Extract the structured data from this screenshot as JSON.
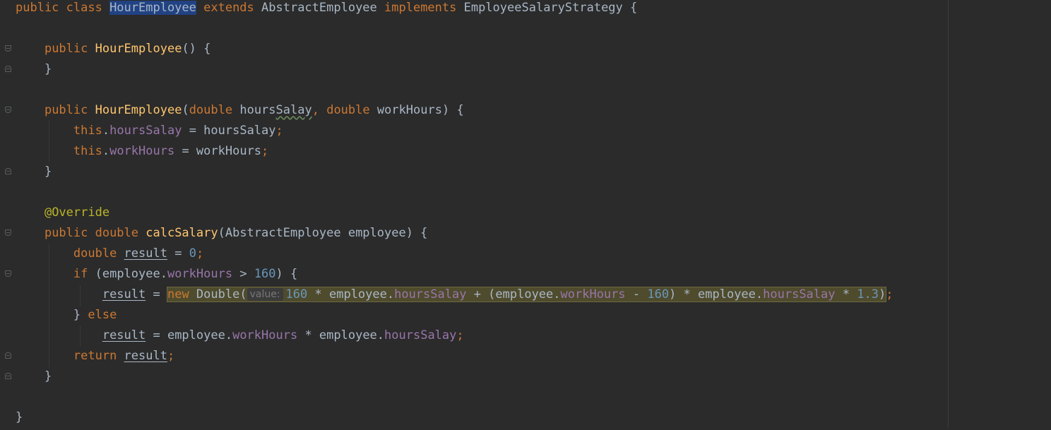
{
  "editor": {
    "lines": {
      "l1": {
        "kw1": "public class ",
        "name": "HourEmployee",
        "kw2": " extends ",
        "parent": "AbstractEmployee",
        "kw3": " implements ",
        "iface": "EmployeeSalaryStrategy",
        "rest": " {"
      },
      "l3": {
        "kw": "public ",
        "name": "HourEmployee",
        "rest": "() {"
      },
      "l4": {
        "text": "}"
      },
      "l6": {
        "kw": "public ",
        "name": "HourEmployee",
        "p1": "(",
        "t1": "double",
        "a1pre": " hours",
        "a1typo": "Salay",
        "comma": ", ",
        "t2": "double",
        "a2": " workHours",
        "rest": ") {"
      },
      "l7": {
        "kw": "this",
        "dot": ".",
        "fld": "hoursSalay",
        "eq": " = hoursSalay",
        "semi": ";"
      },
      "l8": {
        "kw": "this",
        "dot": ".",
        "fld": "workHours",
        "eq": " = workHours",
        "semi": ";"
      },
      "l9": {
        "text": "}"
      },
      "l11": {
        "ann": "@Override"
      },
      "l12": {
        "kw": "public double ",
        "name": "calcSalary",
        "rest": "(AbstractEmployee employee) {"
      },
      "l13": {
        "kw": "double ",
        "var": "result",
        "eq": " = ",
        "num": "0",
        "semi": ";"
      },
      "l14": {
        "kw": "if",
        "p1": " (employee.",
        "fld": "workHours",
        "op": " > ",
        "num": "160",
        "rest": ") {"
      },
      "l15": {
        "var": "result",
        "eq": " = ",
        "kw": "new",
        "cls": " Double(",
        "hint": "value:",
        "num1": "160",
        "m1": " * employee.",
        "fld1": "hoursSalay",
        "m2": " + (employee.",
        "fld2": "workHours",
        "m3": " - ",
        "num2": "160",
        "m4": ") * employee.",
        "fld3": "hoursSalay",
        "m5": " * ",
        "num3": "1.3",
        "close": ")",
        "semi": ";"
      },
      "l16": {
        "brace": "} ",
        "kw": "else"
      },
      "l17": {
        "var": "result",
        "m1": " = employee.",
        "fld1": "workHours",
        "m2": " * employee.",
        "fld2": "hoursSalay",
        "semi": ";"
      },
      "l18": {
        "kw": "return ",
        "var": "result",
        "semi": ";"
      },
      "l19": {
        "text": "}"
      },
      "l21": {
        "text": "}"
      }
    }
  }
}
